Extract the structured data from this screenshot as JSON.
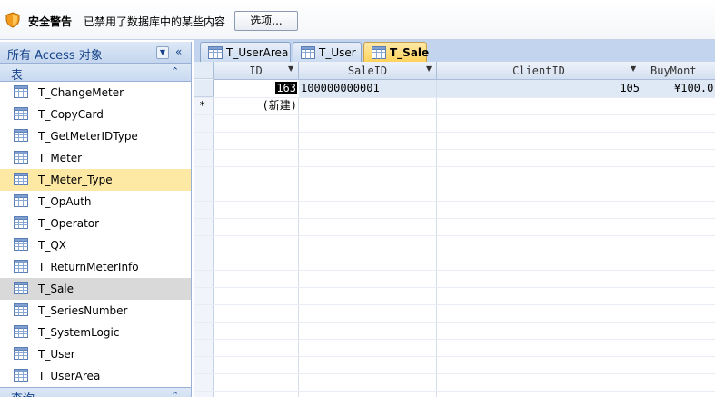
{
  "security_bar": {
    "title": "安全警告",
    "message": "已禁用了数据库中的某些内容",
    "options_button": "选项..."
  },
  "nav": {
    "header_title": "所有 Access 对象",
    "group_tables": "表",
    "group_queries": "查询",
    "items": [
      {
        "label": "T_ChangeMeter"
      },
      {
        "label": "T_CopyCard"
      },
      {
        "label": "T_GetMeterIDType"
      },
      {
        "label": "T_Meter"
      },
      {
        "label": "T_Meter_Type"
      },
      {
        "label": "T_OpAuth"
      },
      {
        "label": "T_Operator"
      },
      {
        "label": "T_QX"
      },
      {
        "label": "T_ReturnMeterInfo"
      },
      {
        "label": "T_Sale"
      },
      {
        "label": "T_SeriesNumber"
      },
      {
        "label": "T_SystemLogic"
      },
      {
        "label": "T_User"
      },
      {
        "label": "T_UserArea"
      }
    ],
    "highlighted_item": "T_Meter_Type",
    "selected_item": "T_Sale"
  },
  "tabs": [
    {
      "label": "T_UserArea",
      "active": false
    },
    {
      "label": "T_User",
      "active": false
    },
    {
      "label": "T_Sale",
      "active": true
    }
  ],
  "datasheet": {
    "columns": [
      {
        "label": "ID"
      },
      {
        "label": "SaleID"
      },
      {
        "label": "ClientID"
      },
      {
        "label": "BuyMont"
      }
    ],
    "rows": [
      {
        "id": "163",
        "sale_id": "100000000001",
        "client_id": "105",
        "buy_money": "¥100.0"
      }
    ],
    "new_row_marker": "*",
    "new_row_label": "(新建)"
  },
  "colors": {
    "nav_highlight": "#fde8a4",
    "nav_selected": "#d9d9d9",
    "active_tab": "#ffd35c",
    "header_blue": "#15428b"
  }
}
